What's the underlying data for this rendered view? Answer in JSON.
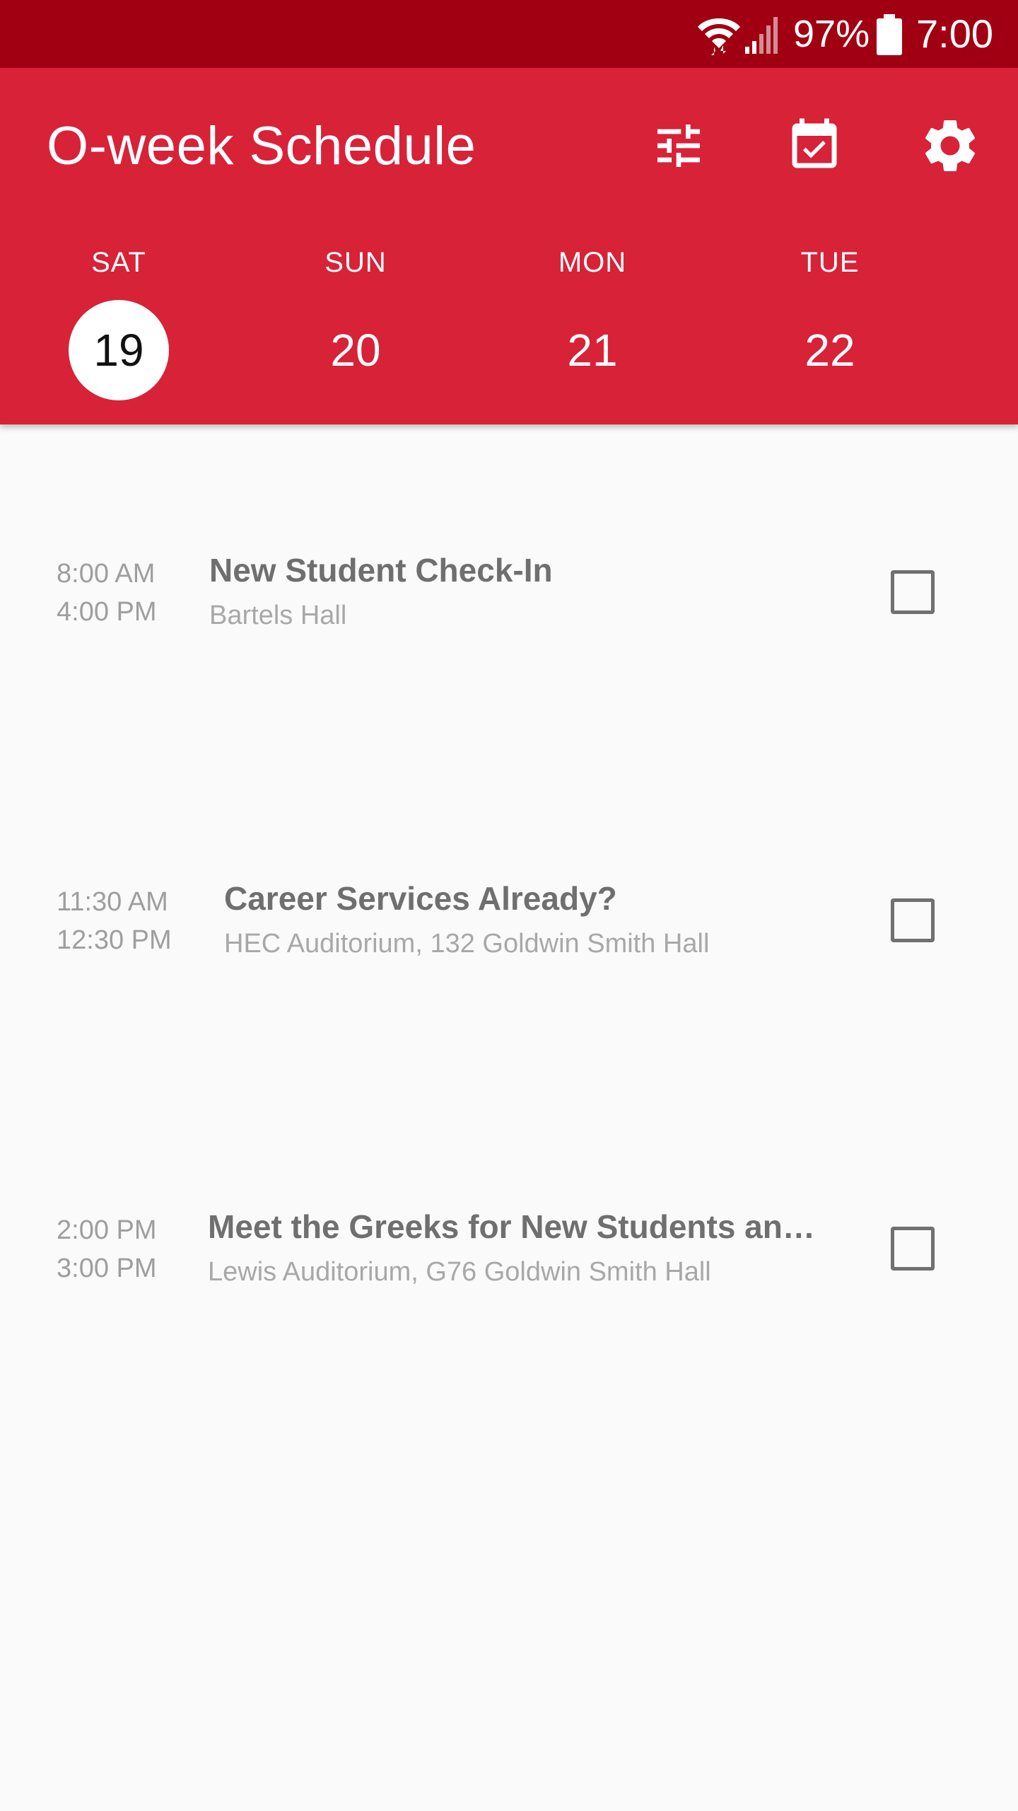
{
  "status_bar": {
    "battery": "97%",
    "time": "7:00",
    "icons": [
      "wifi-icon",
      "cell-signal-icon",
      "battery-icon"
    ]
  },
  "app_bar": {
    "title": "O-week Schedule",
    "actions": [
      "tune-filter-icon",
      "calendar-check-icon",
      "settings-gear-icon"
    ],
    "color": "#d72238"
  },
  "days": [
    {
      "name": "SAT",
      "number": "19",
      "selected": true
    },
    {
      "name": "SUN",
      "number": "20",
      "selected": false
    },
    {
      "name": "MON",
      "number": "21",
      "selected": false
    },
    {
      "name": "TUE",
      "number": "22",
      "selected": false
    }
  ],
  "events": [
    {
      "start": "8:00 AM",
      "end": "4:00 PM",
      "title": "New Student Check-In",
      "location": "Bartels Hall",
      "checked": false
    },
    {
      "start": "11:30 AM",
      "end": "12:30 PM",
      "title": "Career Services Already?",
      "location": "HEC Auditorium, 132 Goldwin Smith Hall",
      "checked": false
    },
    {
      "start": "2:00 PM",
      "end": "3:00 PM",
      "title": "Meet the Greeks for New Students an…",
      "location": "Lewis Auditorium, G76 Goldwin Smith Hall",
      "checked": false
    }
  ]
}
